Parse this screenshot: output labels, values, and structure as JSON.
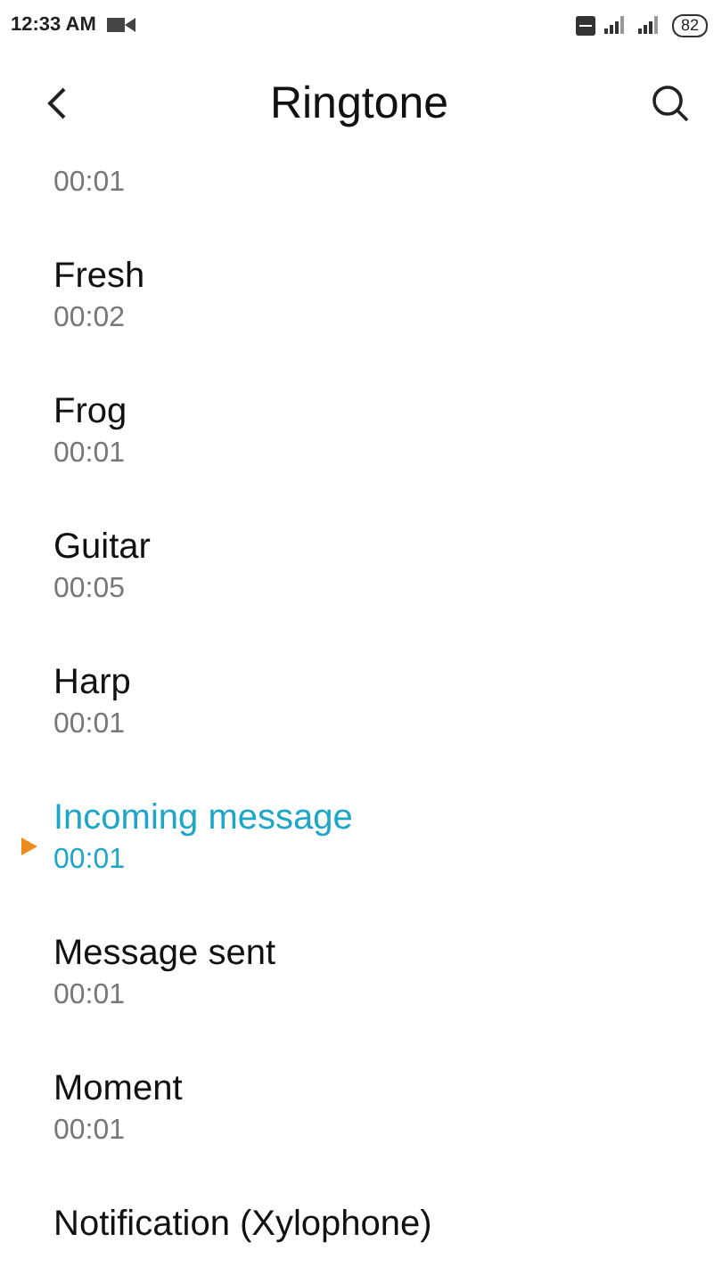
{
  "status_bar": {
    "time": "12:33 AM",
    "battery": "82"
  },
  "header": {
    "title": "Ringtone"
  },
  "ringtones": [
    {
      "duration": "00:01",
      "selected": false
    },
    {
      "name": "Fresh",
      "duration": "00:02",
      "selected": false
    },
    {
      "name": "Frog",
      "duration": "00:01",
      "selected": false
    },
    {
      "name": "Guitar",
      "duration": "00:05",
      "selected": false
    },
    {
      "name": "Harp",
      "duration": "00:01",
      "selected": false
    },
    {
      "name": "Incoming message",
      "duration": "00:01",
      "selected": true
    },
    {
      "name": "Message sent",
      "duration": "00:01",
      "selected": false
    },
    {
      "name": "Moment",
      "duration": "00:01",
      "selected": false
    },
    {
      "name": "Notification (Xylophone)",
      "selected": false
    }
  ]
}
